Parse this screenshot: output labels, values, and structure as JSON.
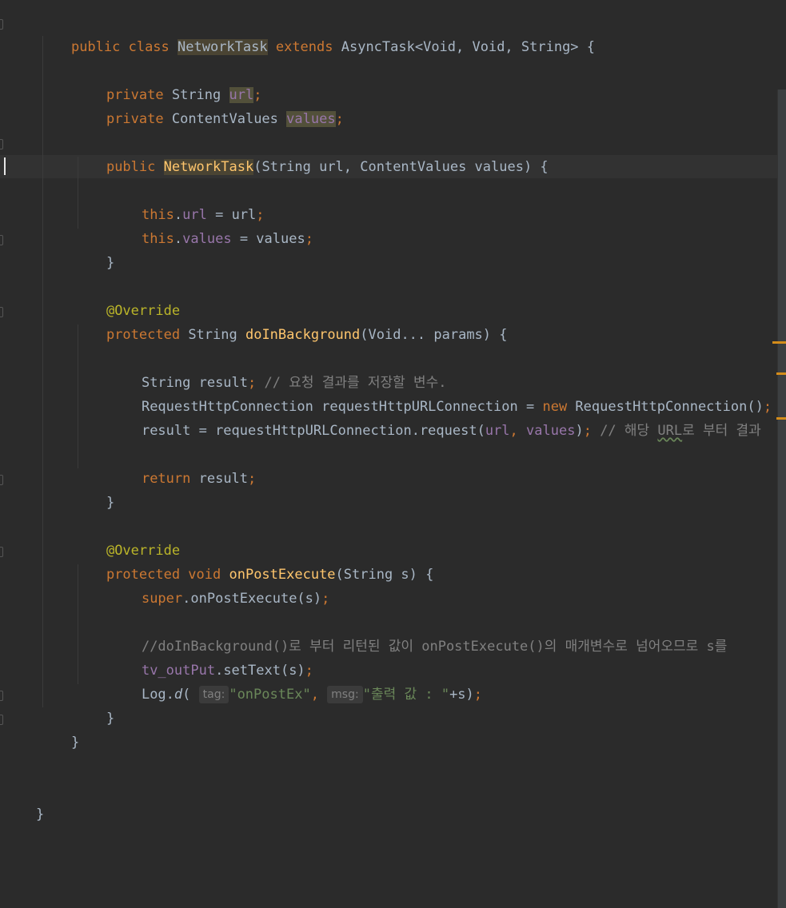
{
  "editor": {
    "colors": {
      "background": "#2b2b2b",
      "keyword": "#cc7832",
      "field": "#9876aa",
      "method": "#ffc66d",
      "annotation": "#bbb529",
      "string": "#6a8759",
      "comment": "#808080",
      "text": "#a9b7c6"
    },
    "lines": {
      "l1": {
        "kw1": "public class ",
        "cls": "NetworkTask",
        "kw2": " extends ",
        "rest": "AsyncTask<Void, Void, String> {"
      },
      "l3": {
        "kw": "private ",
        "type": "String ",
        "fld": "url",
        "semi": ";"
      },
      "l4": {
        "kw": "private ",
        "type": "ContentValues ",
        "fld": "values",
        "semi": ";"
      },
      "l6": {
        "kw": "public ",
        "fn": "NetworkTask",
        "rest": "(String url, ContentValues values) {"
      },
      "l8": {
        "kw": "this",
        "dot": ".",
        "fld": "url",
        "rest": " = url",
        "semi": ";"
      },
      "l9": {
        "kw": "this",
        "dot": ".",
        "fld": "values",
        "rest": " = values",
        "semi": ";"
      },
      "l10": {
        "text": "}"
      },
      "l12": {
        "ann": "@Override"
      },
      "l13": {
        "kw": "protected ",
        "type": "String ",
        "fn": "doInBackground",
        "rest": "(Void... params) {"
      },
      "l15": {
        "code": "String result",
        "semi": "; ",
        "cmt": "// 요청 결과를 저장할 변수."
      },
      "l16": {
        "code": "RequestHttpConnection requestHttpURLConnection = ",
        "kw": "new ",
        "rest": "RequestHttpConnection()",
        "semi": ";"
      },
      "l17": {
        "code": "result = requestHttpURLConnection.request(",
        "fld1": "url",
        "comma": ", ",
        "fld2": "values",
        "close": ")",
        "semi": "; ",
        "cmt1": "// 해당 ",
        "cmt_url": "URL",
        "cmt2": "로 부터 결과"
      },
      "l19": {
        "kw": "return ",
        "rest": "result",
        "semi": ";"
      },
      "l20": {
        "text": "}"
      },
      "l22": {
        "ann": "@Override"
      },
      "l23": {
        "kw": "protected void ",
        "fn": "onPostExecute",
        "rest": "(String s) {"
      },
      "l24": {
        "kw": "super",
        "rest": ".onPostExecute(s)",
        "semi": ";"
      },
      "l26": {
        "cmt": "//doInBackground()로 부터 리턴된 값이 onPostExecute()의 매개변수로 넘어오므로 s를"
      },
      "l27": {
        "fld": "tv_outPut",
        "rest": ".setText(s)",
        "semi": ";"
      },
      "l28": {
        "cls": "Log.",
        "method": "d",
        "open": "(",
        "hint_tag": "tag:",
        "str1": "\"onPostEx\"",
        "comma": ", ",
        "hint_msg": "msg:",
        "str2": "\"출력 값 : \"",
        "rest": "+s)",
        "semi": ";"
      },
      "l29": {
        "text": "}"
      },
      "l30": {
        "text": "}"
      },
      "l33": {
        "text": "}"
      }
    }
  }
}
